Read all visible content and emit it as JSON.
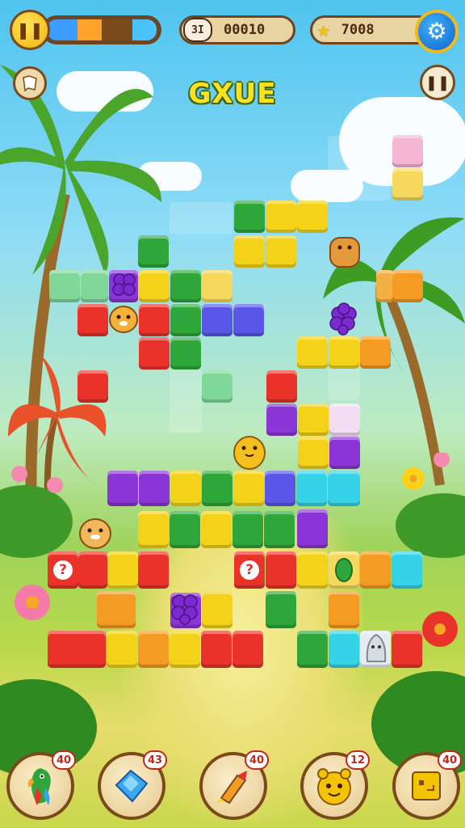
{
  "hud": {
    "level_label": "3I",
    "score": "00010",
    "coins": "7008",
    "progress_segments": [
      {
        "color": "#3c9cff",
        "fraction": 0.28
      },
      {
        "color": "#ffa22a",
        "fraction": 0.22
      },
      {
        "color": "#7b4a1b",
        "fraction": 0.28
      },
      {
        "color": "#49c4ff",
        "fraction": 0.22
      }
    ]
  },
  "title": "GXUE",
  "colors": {
    "green": "#2ea63a",
    "yellow": "#f5d21a",
    "orange": "#f59a22",
    "red": "#e8322a",
    "purple": "#8b35d6",
    "cyan": "#35d2e8",
    "blue": "#5a57e8",
    "mint": "#7fd79a"
  },
  "board": {
    "mystery_mark": "?",
    "mystery_count": 2
  },
  "powerups": [
    {
      "name": "parrot",
      "icon": "parrot-icon",
      "count": "40"
    },
    {
      "name": "gem",
      "icon": "blue-gem-icon",
      "count": "43"
    },
    {
      "name": "rocket",
      "icon": "rocket-icon",
      "count": "40"
    },
    {
      "name": "hamster",
      "icon": "hamster-face-icon",
      "count": "12"
    },
    {
      "name": "box",
      "icon": "yellow-box-icon",
      "count": "40"
    }
  ]
}
